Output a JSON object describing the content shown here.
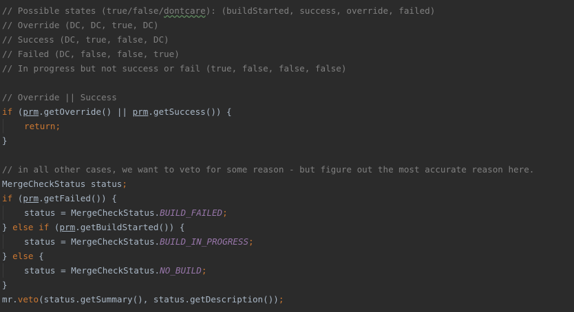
{
  "code": {
    "l1": {
      "pre": "// Possible states (true/false/",
      "wavy": "dontcare",
      "post": "): (buildStarted, success, override, failed)"
    },
    "l2": "// Override (DC, DC, true, DC)",
    "l3": "// Success (DC, true, false, DC)",
    "l4": "// Failed (DC, false, false, true)",
    "l5": "// In progress but not success or fail (true, false, false, false)",
    "l7": "// Override || Success",
    "l8": {
      "kw": "if",
      "a": " (",
      "var1": "prm",
      "b": ".getOverride() || ",
      "var2": "prm",
      "c": ".getSuccess()) {"
    },
    "l9": {
      "kw": "return",
      "semi": ";"
    },
    "l10": "}",
    "l12": "// in all other cases, we want to veto for some reason - but figure out the most accurate reason here.",
    "l13": {
      "text": "MergeCheckStatus status",
      "semi": ";"
    },
    "l14": {
      "kw": "if",
      "a": " (",
      "var": "prm",
      "b": ".getFailed()) {"
    },
    "l15": {
      "a": "status = MergeCheckStatus.",
      "const": "BUILD_FAILED",
      "semi": ";"
    },
    "l16": {
      "a": "} ",
      "kw1": "else",
      "sp": " ",
      "kw2": "if",
      "b": " (",
      "var": "prm",
      "c": ".getBuildStarted()) {"
    },
    "l17": {
      "a": "status = MergeCheckStatus.",
      "const": "BUILD_IN_PROGRESS",
      "semi": ";"
    },
    "l18": {
      "a": "} ",
      "kw": "else",
      "b": " {"
    },
    "l19": {
      "a": "status = MergeCheckStatus.",
      "const": "NO_BUILD",
      "semi": ";"
    },
    "l20": "}",
    "l21": {
      "a": "mr.",
      "fn": "veto",
      "b": "(status.getSummary(), status.getDescription())",
      "semi": ";"
    }
  },
  "colors": {
    "background": "#2b2b2b",
    "text": "#a9b7c6",
    "comment": "#808080",
    "keyword": "#cc7832",
    "constant": "#9876aa"
  }
}
